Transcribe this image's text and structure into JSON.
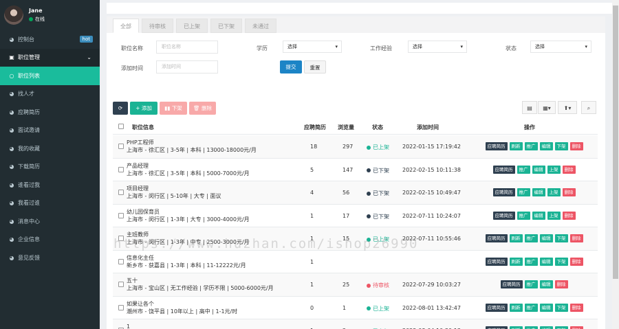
{
  "user": {
    "name": "Jane",
    "status": "在线",
    "status_color": "#00a65a"
  },
  "sidebar": {
    "items": [
      {
        "label": "控制台",
        "icon": "dashboard-icon",
        "badge": "hot"
      },
      {
        "label": "职位管理",
        "icon": "briefcase-icon"
      },
      {
        "label": "职位列表",
        "icon": "circle-icon"
      },
      {
        "label": "找人才",
        "icon": "dashboard-icon"
      },
      {
        "label": "应聘简历",
        "icon": "dashboard-icon"
      },
      {
        "label": "面试邀请",
        "icon": "dashboard-icon"
      },
      {
        "label": "我的收藏",
        "icon": "dashboard-icon"
      },
      {
        "label": "下载简历",
        "icon": "dashboard-icon"
      },
      {
        "label": "谁看过我",
        "icon": "dashboard-icon"
      },
      {
        "label": "我看过谁",
        "icon": "dashboard-icon"
      },
      {
        "label": "消息中心",
        "icon": "dashboard-icon"
      },
      {
        "label": "企业信息",
        "icon": "dashboard-icon"
      },
      {
        "label": "意见反馈",
        "icon": "dashboard-icon"
      }
    ]
  },
  "tabs": [
    "全部",
    "待审核",
    "已上架",
    "已下架",
    "未通过"
  ],
  "filters": {
    "name_label": "职位名称",
    "name_placeholder": "职位名称",
    "edu_label": "学历",
    "edu_value": "选择",
    "exp_label": "工作经验",
    "exp_value": "选择",
    "state_label": "状态",
    "state_value": "选择",
    "time_label": "添加时间",
    "time_placeholder": "添加时间",
    "submit": "提交",
    "reset": "重置"
  },
  "toolbar": {
    "add": "添加",
    "offline": "下架",
    "delete": "删除"
  },
  "table": {
    "headers": {
      "info": "职位信息",
      "resumes": "应聘简历",
      "views": "浏览量",
      "status": "状态",
      "time": "添加时间",
      "ops": "操作"
    },
    "rows": [
      {
        "title": "PHP工程师",
        "desc": "上海市 - 徐汇区 | 3-5年 | 本科 | 13000-18000元/月",
        "resumes": "18",
        "views": "297",
        "status": "已上架",
        "status_color": "#1ab394",
        "time": "2022-01-15 17:19:42",
        "ops": [
          [
            "应聘简历",
            "dark"
          ],
          [
            "刷新",
            "teal"
          ],
          [
            "推广",
            "teal"
          ],
          [
            "编辑",
            "teal"
          ],
          [
            "下架",
            "teal"
          ],
          [
            "删除",
            "red"
          ]
        ]
      },
      {
        "title": "产品经理",
        "desc": "上海市 - 徐汇区 | 3-5年 | 本科 | 5000-7000元/月",
        "resumes": "5",
        "views": "147",
        "status": "已下架",
        "status_color": "#2f4050",
        "time": "2022-02-15 10:11:38",
        "ops": [
          [
            "应聘简历",
            "dark"
          ],
          [
            "推广",
            "teal"
          ],
          [
            "编辑",
            "teal"
          ],
          [
            "上架",
            "teal"
          ],
          [
            "删除",
            "red"
          ]
        ]
      },
      {
        "title": "项目经理",
        "desc": "上海市 - 闵行区 | 5-10年 | 大专 | 面议",
        "resumes": "4",
        "views": "56",
        "status": "已下架",
        "status_color": "#2f4050",
        "time": "2022-02-15 10:49:47",
        "ops": [
          [
            "应聘简历",
            "dark"
          ],
          [
            "推广",
            "teal"
          ],
          [
            "编辑",
            "teal"
          ],
          [
            "上架",
            "teal"
          ],
          [
            "删除",
            "red"
          ]
        ]
      },
      {
        "title": "幼儿园保育员",
        "desc": "上海市 - 闵行区 | 1-3年 | 大专 | 3000-4000元/月",
        "resumes": "1",
        "views": "17",
        "status": "已下架",
        "status_color": "#2f4050",
        "time": "2022-07-11 10:24:07",
        "ops": [
          [
            "应聘简历",
            "dark"
          ],
          [
            "推广",
            "teal"
          ],
          [
            "编辑",
            "teal"
          ],
          [
            "上架",
            "teal"
          ],
          [
            "删除",
            "red"
          ]
        ]
      },
      {
        "title": "主班教师",
        "desc": "上海市 - 闵行区 | 1-3年 | 中专 | 2500-3000元/月",
        "resumes": "1",
        "views": "15",
        "status": "已上架",
        "status_color": "#1ab394",
        "time": "2022-07-11 10:55:46",
        "ops": [
          [
            "应聘简历",
            "dark"
          ],
          [
            "刷新",
            "teal"
          ],
          [
            "推广",
            "teal"
          ],
          [
            "编辑",
            "teal"
          ],
          [
            "下架",
            "teal"
          ],
          [
            "删除",
            "red"
          ]
        ]
      },
      {
        "title": "信息化主任",
        "desc": "新乡市 - 获嘉县 | 1-3年 | 本科 | 11-12222元/月",
        "resumes": "1",
        "views": "",
        "status": "",
        "status_color": "#1ab394",
        "time": "",
        "ops": [
          [
            "应聘简历",
            "dark"
          ],
          [
            "刷新",
            "teal"
          ],
          [
            "推广",
            "teal"
          ],
          [
            "编辑",
            "teal"
          ],
          [
            "下架",
            "teal"
          ],
          [
            "删除",
            "red"
          ]
        ]
      },
      {
        "title": "五十",
        "desc": "上海市 - 宝山区 | 无工作经验 | 学历不限 | 5000-6000元/月",
        "resumes": "1",
        "views": "25",
        "status": "待审核",
        "status_color": "#ed5565",
        "time": "2022-07-29 10:03:27",
        "ops": [
          [
            "应聘简历",
            "dark"
          ],
          [
            "推广",
            "teal"
          ],
          [
            "编辑",
            "teal"
          ],
          [
            "删除",
            "red"
          ]
        ]
      },
      {
        "title": "如果让各个",
        "desc": "潮州市 - 饶平县 | 10年以上 | 高中 | 1-1元/时",
        "resumes": "0",
        "views": "1",
        "status": "已上架",
        "status_color": "#1ab394",
        "time": "2022-08-01 13:42:47",
        "ops": [
          [
            "应聘简历",
            "dark"
          ],
          [
            "刷新",
            "teal"
          ],
          [
            "推广",
            "teal"
          ],
          [
            "编辑",
            "teal"
          ],
          [
            "下架",
            "teal"
          ],
          [
            "删除",
            "red"
          ]
        ]
      },
      {
        "title": "1",
        "desc": "百色市 - 德保县 | 无工作经验 | 学历不限 | 1-1元/月",
        "resumes": "1",
        "views": "2",
        "status": "已上架",
        "status_color": "#1ab394",
        "time": "2022-08-04 10:30:13",
        "ops": [
          [
            "应聘简历",
            "dark"
          ],
          [
            "刷新",
            "teal"
          ],
          [
            "推广",
            "teal"
          ],
          [
            "编辑",
            "teal"
          ],
          [
            "下架",
            "teal"
          ],
          [
            "删除",
            "red"
          ]
        ]
      }
    ]
  },
  "watermark": "https://www.huzhan.com/ishop26990"
}
